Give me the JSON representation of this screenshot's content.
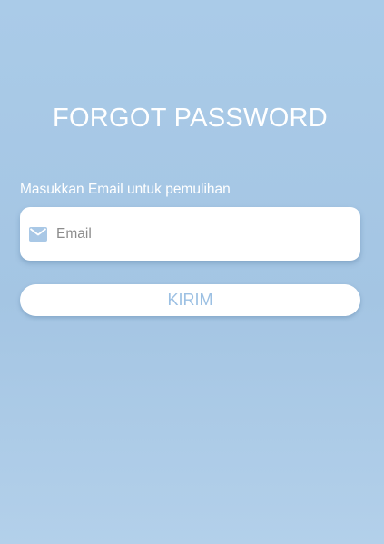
{
  "page": {
    "title": "FORGOT PASSWORD"
  },
  "form": {
    "email_label": "Masukkan Email untuk pemulihan",
    "email_placeholder": "Email",
    "email_value": "",
    "email_icon": "mail-icon",
    "submit_label": "KIRIM"
  },
  "colors": {
    "background": "#a8c9e6",
    "accent": "#9cc0e3",
    "icon": "#a9c8e6",
    "text_on_background": "#ffffff"
  }
}
